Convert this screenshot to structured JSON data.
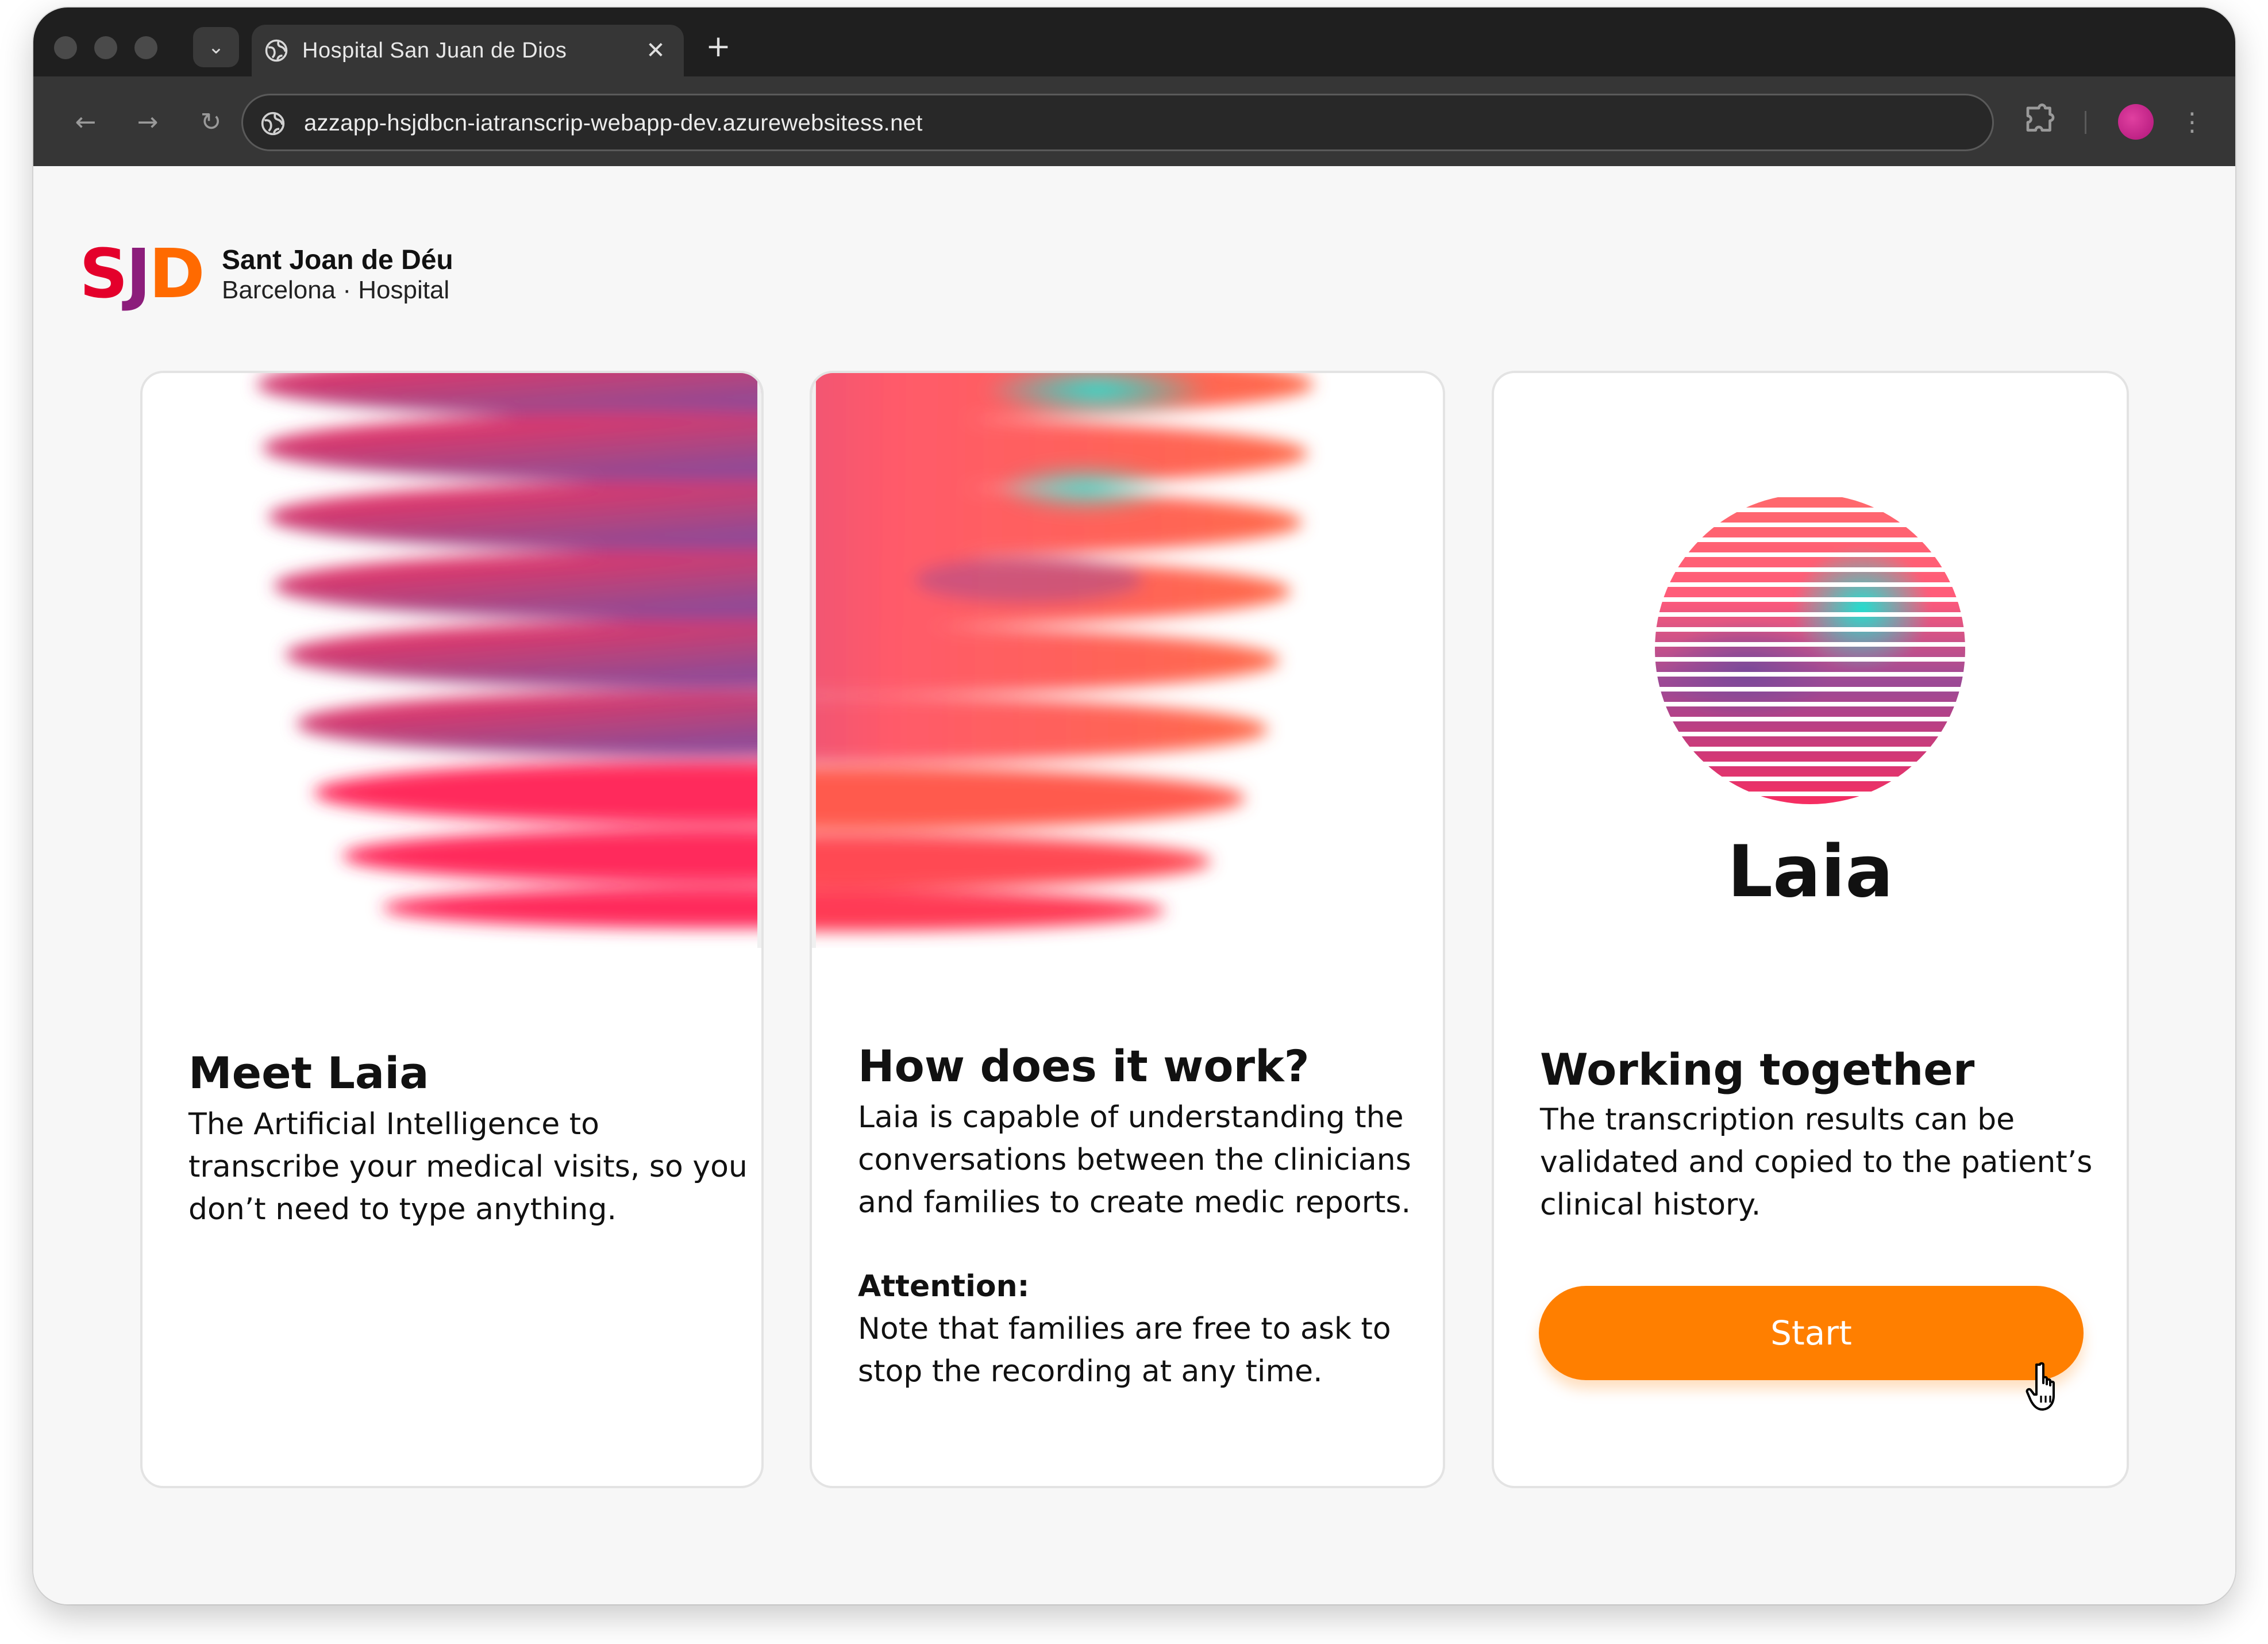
{
  "browser": {
    "tab_title": "Hospital San Juan de Dios",
    "tab_close_glyph": "✕",
    "new_tab_glyph": "+",
    "tab_search_glyph": "⌄",
    "url": "azzapp-hsjdbcn-iatranscrip-webapp-dev.azurewebsitess.net",
    "nav": {
      "back_glyph": "←",
      "forward_glyph": "→",
      "reload_glyph": "↻",
      "menu_glyph": "⋮"
    },
    "profile_color": "#c81e8c"
  },
  "logo": {
    "mark_s": "S",
    "mark_j": "J",
    "mark_d": "D",
    "name": "Sant Joan de Déu",
    "subtitle": "Barcelona · Hospital",
    "colors": {
      "s": "#e4002b",
      "j": "#8c1d7b",
      "d": "#ff6a00"
    }
  },
  "cards": [
    {
      "heading": "Meet Laia",
      "body_lines": [
        "The Artificial Intelligence to",
        "transcribe your medical visits, so you",
        "don’t need to type anything."
      ]
    },
    {
      "heading": "How does it work?",
      "body_lines": [
        "Laia is capable of understanding the",
        "conversations between the clinicians",
        "and families to create medic reports."
      ],
      "attention_title": "Attention:",
      "attention_lines": [
        "Note that families are free to ask to",
        "stop the recording at any time."
      ]
    },
    {
      "brand_label": "Laia",
      "heading": "Working together",
      "body_lines": [
        "The transcription results can be",
        "validated and copied to the patient’s",
        "clinical history."
      ],
      "button_label": "Start"
    }
  ],
  "theme": {
    "accent": "#ff7f00",
    "gradient_pink": "#ff2a5c",
    "gradient_purple": "#8a4a9a",
    "gradient_teal": "#1fe0d0",
    "gradient_orange": "#ff6a4a"
  }
}
